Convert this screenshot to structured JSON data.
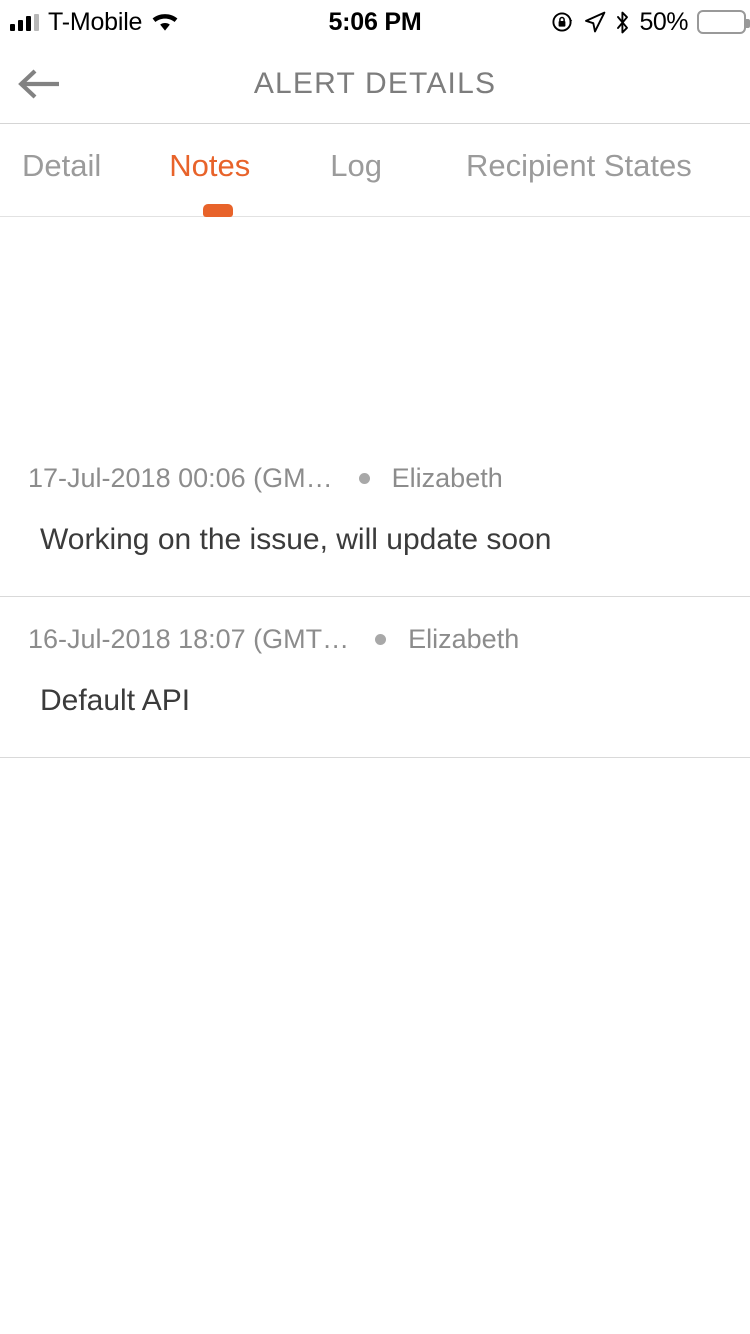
{
  "status_bar": {
    "carrier": "T-Mobile",
    "time": "5:06 PM",
    "battery_percent": "50%",
    "signal_icon": "signal-bars-icon",
    "wifi_icon": "wifi-icon",
    "rotation_lock_icon": "rotation-lock-icon",
    "location_icon": "location-arrow-icon",
    "bluetooth_icon": "bluetooth-icon",
    "battery_icon": "battery-icon"
  },
  "nav": {
    "title": "ALERT DETAILS",
    "back_icon": "back-arrow-icon"
  },
  "tabs": {
    "items": [
      {
        "label": "Detail",
        "active": false
      },
      {
        "label": "Notes",
        "active": true
      },
      {
        "label": "Log",
        "active": false
      },
      {
        "label": "Recipient States",
        "active": false
      }
    ],
    "active_index": 1
  },
  "notes": [
    {
      "timestamp": "17-Jul-2018 00:06 (GM…",
      "author": "Elizabeth",
      "body": "Working on the issue, will update soon"
    },
    {
      "timestamp": "16-Jul-2018 18:07 (GMT…",
      "author": "Elizabeth",
      "body": "Default API"
    }
  ],
  "colors": {
    "accent": "#e8632a",
    "muted_text": "#8c8c8c",
    "title_text": "#7d7d7d",
    "body_text": "#3b3b3b",
    "divider": "#d9d9d9",
    "background": "#ffffff"
  }
}
